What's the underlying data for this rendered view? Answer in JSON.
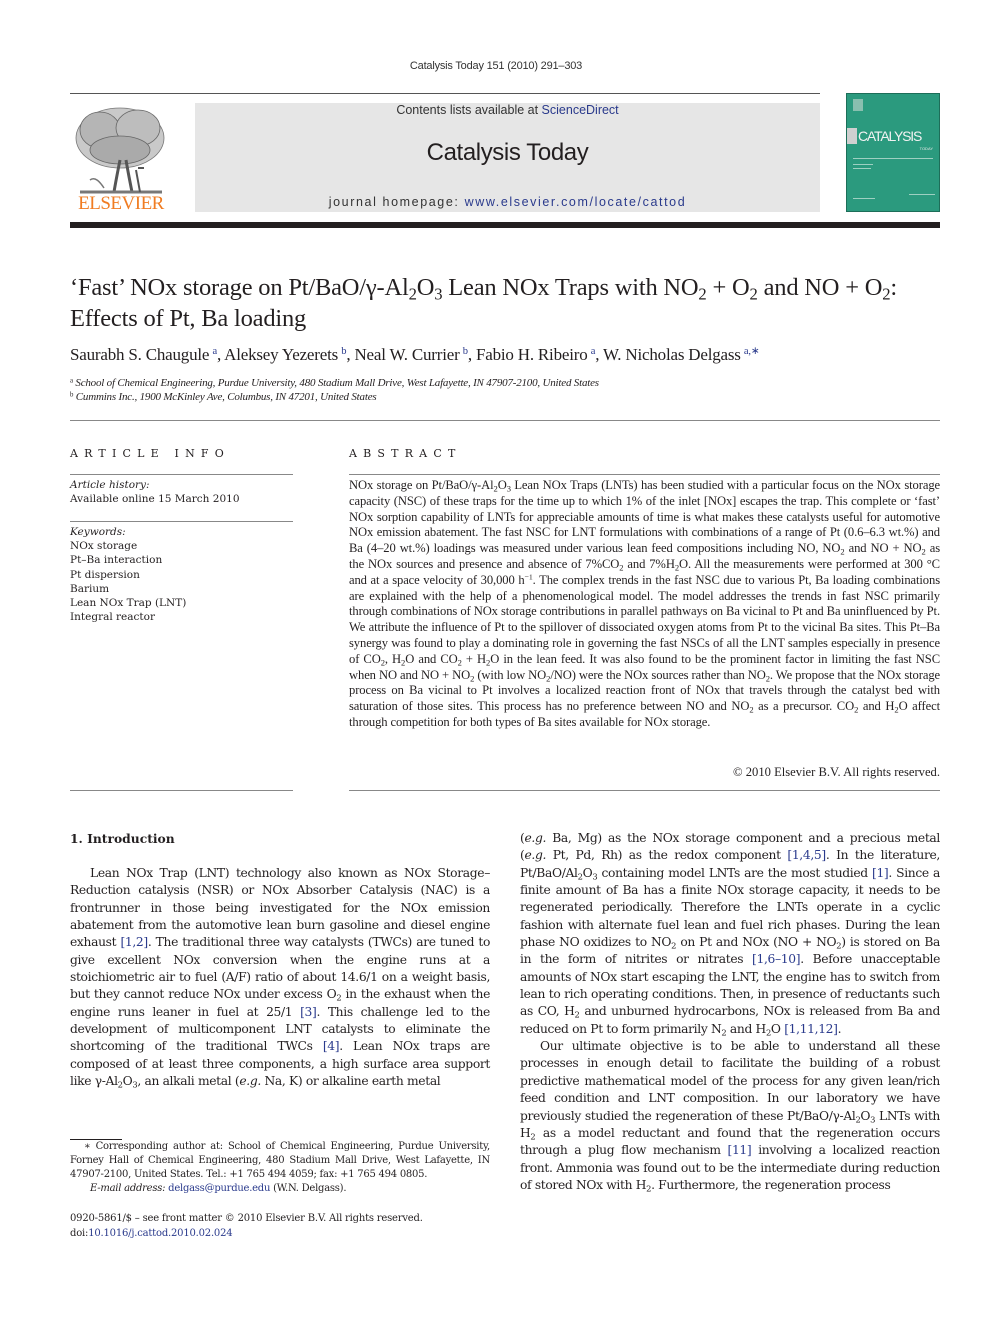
{
  "header": {
    "running_head": "Catalysis Today 151 (2010) 291–303",
    "contents_prefix": "Contents lists available at ",
    "contents_link": "ScienceDirect",
    "journal_title": "Catalysis Today",
    "homepage_prefix": "journal homepage: ",
    "homepage_link": "www.elsevier.com/locate/cattod",
    "publisher_logo_text": "ELSEVIER",
    "cover_title": "CATALYSIS",
    "cover_subtitle": "TODAY",
    "colors": {
      "publisher_orange": "#f07c22",
      "link_blue": "#2a3a8c",
      "cover_green": "#2b9a7e",
      "header_box_gray": "#e6e6e6"
    }
  },
  "article": {
    "title_line1_parts": [
      "‘Fast’ NOx storage on Pt/BaO/γ-Al",
      "2",
      "O",
      "3",
      " Lean NOx Traps with NO",
      "2",
      " + O",
      "2",
      " and NO + O",
      "2",
      ":"
    ],
    "title_line2": "Effects of Pt, Ba loading",
    "authors": [
      {
        "name": "Saurabh S. Chaugule",
        "affil": "a"
      },
      {
        "name": "Aleksey Yezerets",
        "affil": "b"
      },
      {
        "name": "Neal W. Currier",
        "affil": "b"
      },
      {
        "name": "Fabio H. Ribeiro",
        "affil": "a"
      },
      {
        "name": "W. Nicholas Delgass",
        "affil": "a,∗"
      }
    ],
    "affiliations": [
      {
        "mark": "a",
        "text": "School of Chemical Engineering, Purdue University, 480 Stadium Mall Drive, West Lafayette, IN 47907-2100, United States"
      },
      {
        "mark": "b",
        "text": "Cummins Inc., 1900 McKinley Ave, Columbus, IN 47201, United States"
      }
    ]
  },
  "article_info": {
    "heading": "ARTICLE INFO",
    "history_label": "Article history:",
    "history_value": "Available online 15 March 2010",
    "keywords_label": "Keywords:",
    "keywords": [
      "NOx storage",
      "Pt–Ba interaction",
      "Pt dispersion",
      "Barium",
      "Lean NOx Trap (LNT)",
      "Integral reactor"
    ]
  },
  "abstract": {
    "heading": "ABSTRACT",
    "copyright": "© 2010 Elsevier B.V. All rights reserved."
  },
  "body": {
    "section_heading": "1.  Introduction",
    "refs": {
      "r1_2": "[1,2]",
      "r3": "[3]",
      "r4": "[4]",
      "r1_4_5": "[1,4,5]",
      "r1": "[1]",
      "r1_6_10": "[1,6–10]",
      "r1_11_12": "[1,11,12]",
      "r11": "[11]"
    }
  },
  "footnote": {
    "star": "∗",
    "text": "Corresponding author at: School of Chemical Engineering, Purdue University, Forney Hall of Chemical Engineering, 480 Stadium Mall Drive, West Lafayette, IN 47907-2100, United States. Tel.: +1 765 494 4059; fax: +1 765 494 0805.",
    "email_label": "E-mail address:",
    "email": "delgass@purdue.edu",
    "email_suffix": "(W.N. Delgass)."
  },
  "front_matter": {
    "issn_line": "0920-5861/$ – see front matter © 2010 Elsevier B.V. All rights reserved.",
    "doi_prefix": "doi:",
    "doi": "10.1016/j.cattod.2010.02.024"
  }
}
